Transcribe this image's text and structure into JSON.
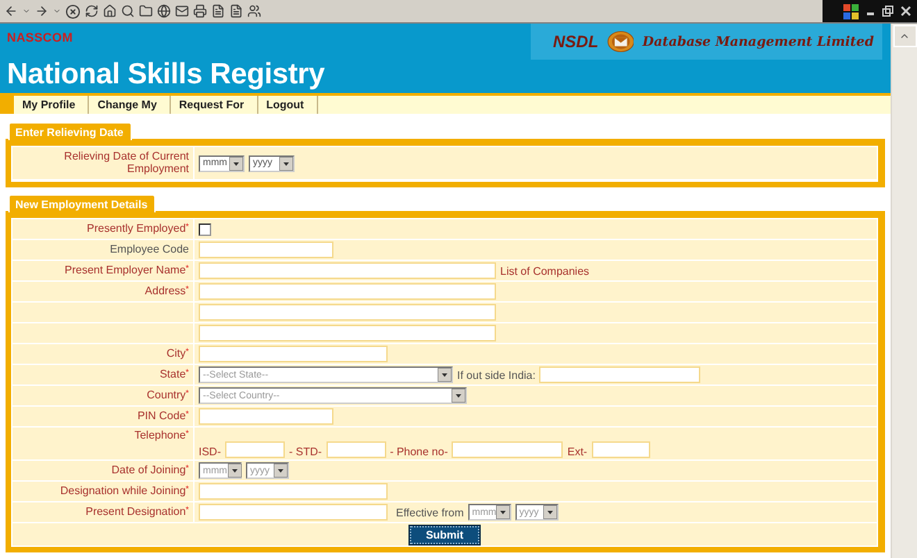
{
  "header": {
    "org": "NASSCOM",
    "title": "National Skills Registry",
    "partner": "NSDL",
    "partner_tagline": "Database Management Limited"
  },
  "nav": [
    {
      "label": "My Profile"
    },
    {
      "label": "Change My"
    },
    {
      "label": "Request For"
    },
    {
      "label": "Logout"
    }
  ],
  "relieving": {
    "title": "Enter Relieving Date",
    "label": "Relieving Date of Current Employment",
    "month": "mmm",
    "year": "yyyy"
  },
  "employment": {
    "title": "New Employment Details",
    "rows": [
      {
        "kind": "checkbox",
        "label": "Presently Employed$^{*}$",
        "required": true,
        "checked": false
      },
      {
        "kind": "short-text",
        "label": "Employee Code",
        "required": false
      },
      {
        "kind": "long-text",
        "label": "Present Employer Name$^{*}$",
        "required": true,
        "link": "List of Companies"
      },
      {
        "kind": "long-text",
        "label": "Address$^{*}$",
        "required": true
      },
      {
        "kind": "long-text"
      },
      {
        "kind": "long-text"
      },
      {
        "kind": "medium-text",
        "label": "City$^{*}$",
        "required": true
      },
      {
        "kind": "select",
        "label": "State$^{*}$",
        "required": true,
        "value": "--Select State--",
        "extra_label": "If out side India:"
      },
      {
        "kind": "wide-select",
        "label": "Country$^{*}$",
        "required": true,
        "value": "--Select Country--"
      },
      {
        "kind": "short-text",
        "label": "PIN Code$^{*}$",
        "required": true
      },
      {
        "kind": "phone",
        "label": "Telephone$^{*}$",
        "required": true,
        "parts": [
          "ISD-",
          "- STD-",
          "- Phone no-",
          "Ext-"
        ]
      },
      {
        "kind": "date",
        "label": "Date of Joining$^{*}$",
        "required": true,
        "month": "mmm",
        "year": "yyyy"
      },
      {
        "kind": "medium-text",
        "label": "Designation while Joining$^{*}$",
        "required": true
      },
      {
        "kind": "medium-text",
        "label": "Present Designation$^{*}$",
        "required": true,
        "effective": {
          "label": "Effective from",
          "month": "mmm",
          "year": "yyyy"
        }
      }
    ],
    "submit": "Submit"
  }
}
